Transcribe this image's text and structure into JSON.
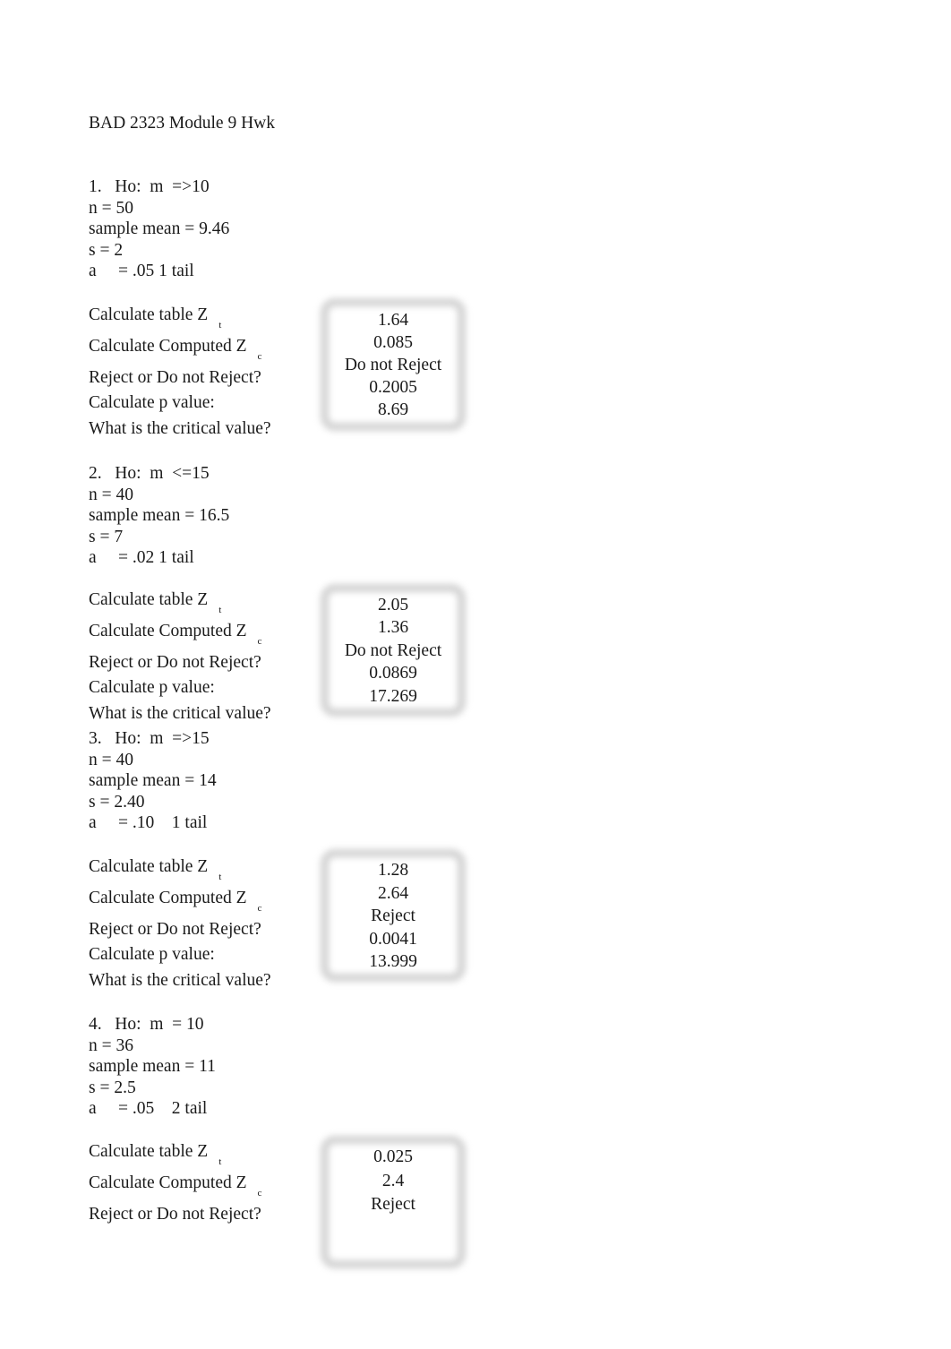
{
  "document": {
    "title": "BAD 2323 Module 9 Hwk"
  },
  "prompt_labels": {
    "table_z": "Calculate table Z",
    "table_z_sub": "t",
    "computed_z": "Calculate Computed Z",
    "computed_z_sub": "c",
    "decision": "Reject or Do not Reject?",
    "p_value": "Calculate p value:",
    "critical_value": "What is the critical value?"
  },
  "questions": [
    {
      "number": "1.",
      "hypothesis": "1.   Ho:  m  =>10",
      "n": "n = 50",
      "sample_mean": "sample mean = 9.46",
      "s": "s = 2",
      "alpha": "a     = .05 1 tail",
      "answers": {
        "table_z": "1.64",
        "computed_z": "0.085",
        "decision": "Do not Reject",
        "p_value": "0.2005",
        "critical_value": "8.69"
      }
    },
    {
      "number": "2.",
      "hypothesis": "2.   Ho:  m  <=15",
      "n": "n = 40",
      "sample_mean": "sample mean = 16.5",
      "s": "s = 7",
      "alpha": "a     = .02 1 tail",
      "answers": {
        "table_z": "2.05",
        "computed_z": "1.36",
        "decision": "Do not Reject",
        "p_value": "0.0869",
        "critical_value": "17.269"
      }
    },
    {
      "number": "3.",
      "hypothesis": "3.   Ho:  m  =>15",
      "n": "n = 40",
      "sample_mean": "sample mean = 14",
      "s": "s = 2.40",
      "alpha": "a     = .10    1 tail",
      "answers": {
        "table_z": "1.28",
        "computed_z": "2.64",
        "decision": "Reject",
        "p_value": "0.0041",
        "critical_value": "13.999"
      }
    },
    {
      "number": "4.",
      "hypothesis": "4.   Ho:  m  = 10",
      "n": "n = 36",
      "sample_mean": "sample mean = 11",
      "s": "s = 2.5",
      "alpha": "a     = .05    2 tail",
      "answers": {
        "table_z": "0.025",
        "computed_z": "2.4",
        "decision": "Reject"
      }
    }
  ],
  "colors": {
    "page_background": "#ffffff",
    "text": "#1a1a1a",
    "answer_box_border": "#d3d3d3"
  }
}
